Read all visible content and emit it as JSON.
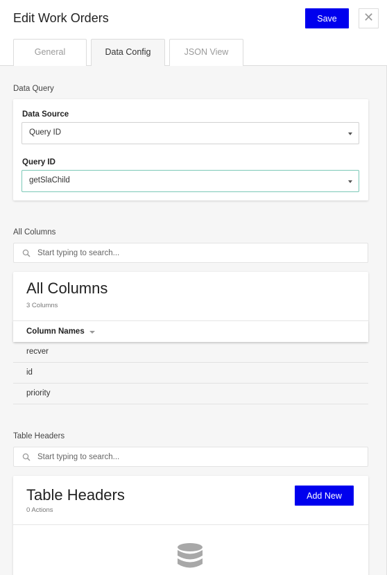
{
  "header": {
    "title": "Edit Work Orders",
    "save_label": "Save",
    "close_glyph": "✕"
  },
  "tabs": [
    {
      "label": "General",
      "active": false
    },
    {
      "label": "Data Config",
      "active": true
    },
    {
      "label": "JSON View",
      "active": false
    }
  ],
  "data_query": {
    "section_label": "Data Query",
    "data_source": {
      "label": "Data Source",
      "value": "Query ID"
    },
    "query_id": {
      "label": "Query ID",
      "value": "getSlaChild"
    }
  },
  "all_columns": {
    "section_label": "All Columns",
    "search_placeholder": "Start typing to search...",
    "card_title": "All Columns",
    "count_text": "3 Columns",
    "column_header": "Column Names",
    "rows": [
      "recver",
      "id",
      "priority"
    ]
  },
  "table_headers": {
    "section_label": "Table Headers",
    "search_placeholder": "Start typing to search...",
    "card_title": "Table Headers",
    "count_text": "0 Actions",
    "add_label": "Add New"
  },
  "colors": {
    "primary": "#0000ee",
    "focus_border": "#7bc8b7",
    "background": "#f6f6f6"
  },
  "icons": [
    "close-icon",
    "search-icon",
    "chevron-down-icon",
    "sort-down-icon",
    "database-icon"
  ]
}
